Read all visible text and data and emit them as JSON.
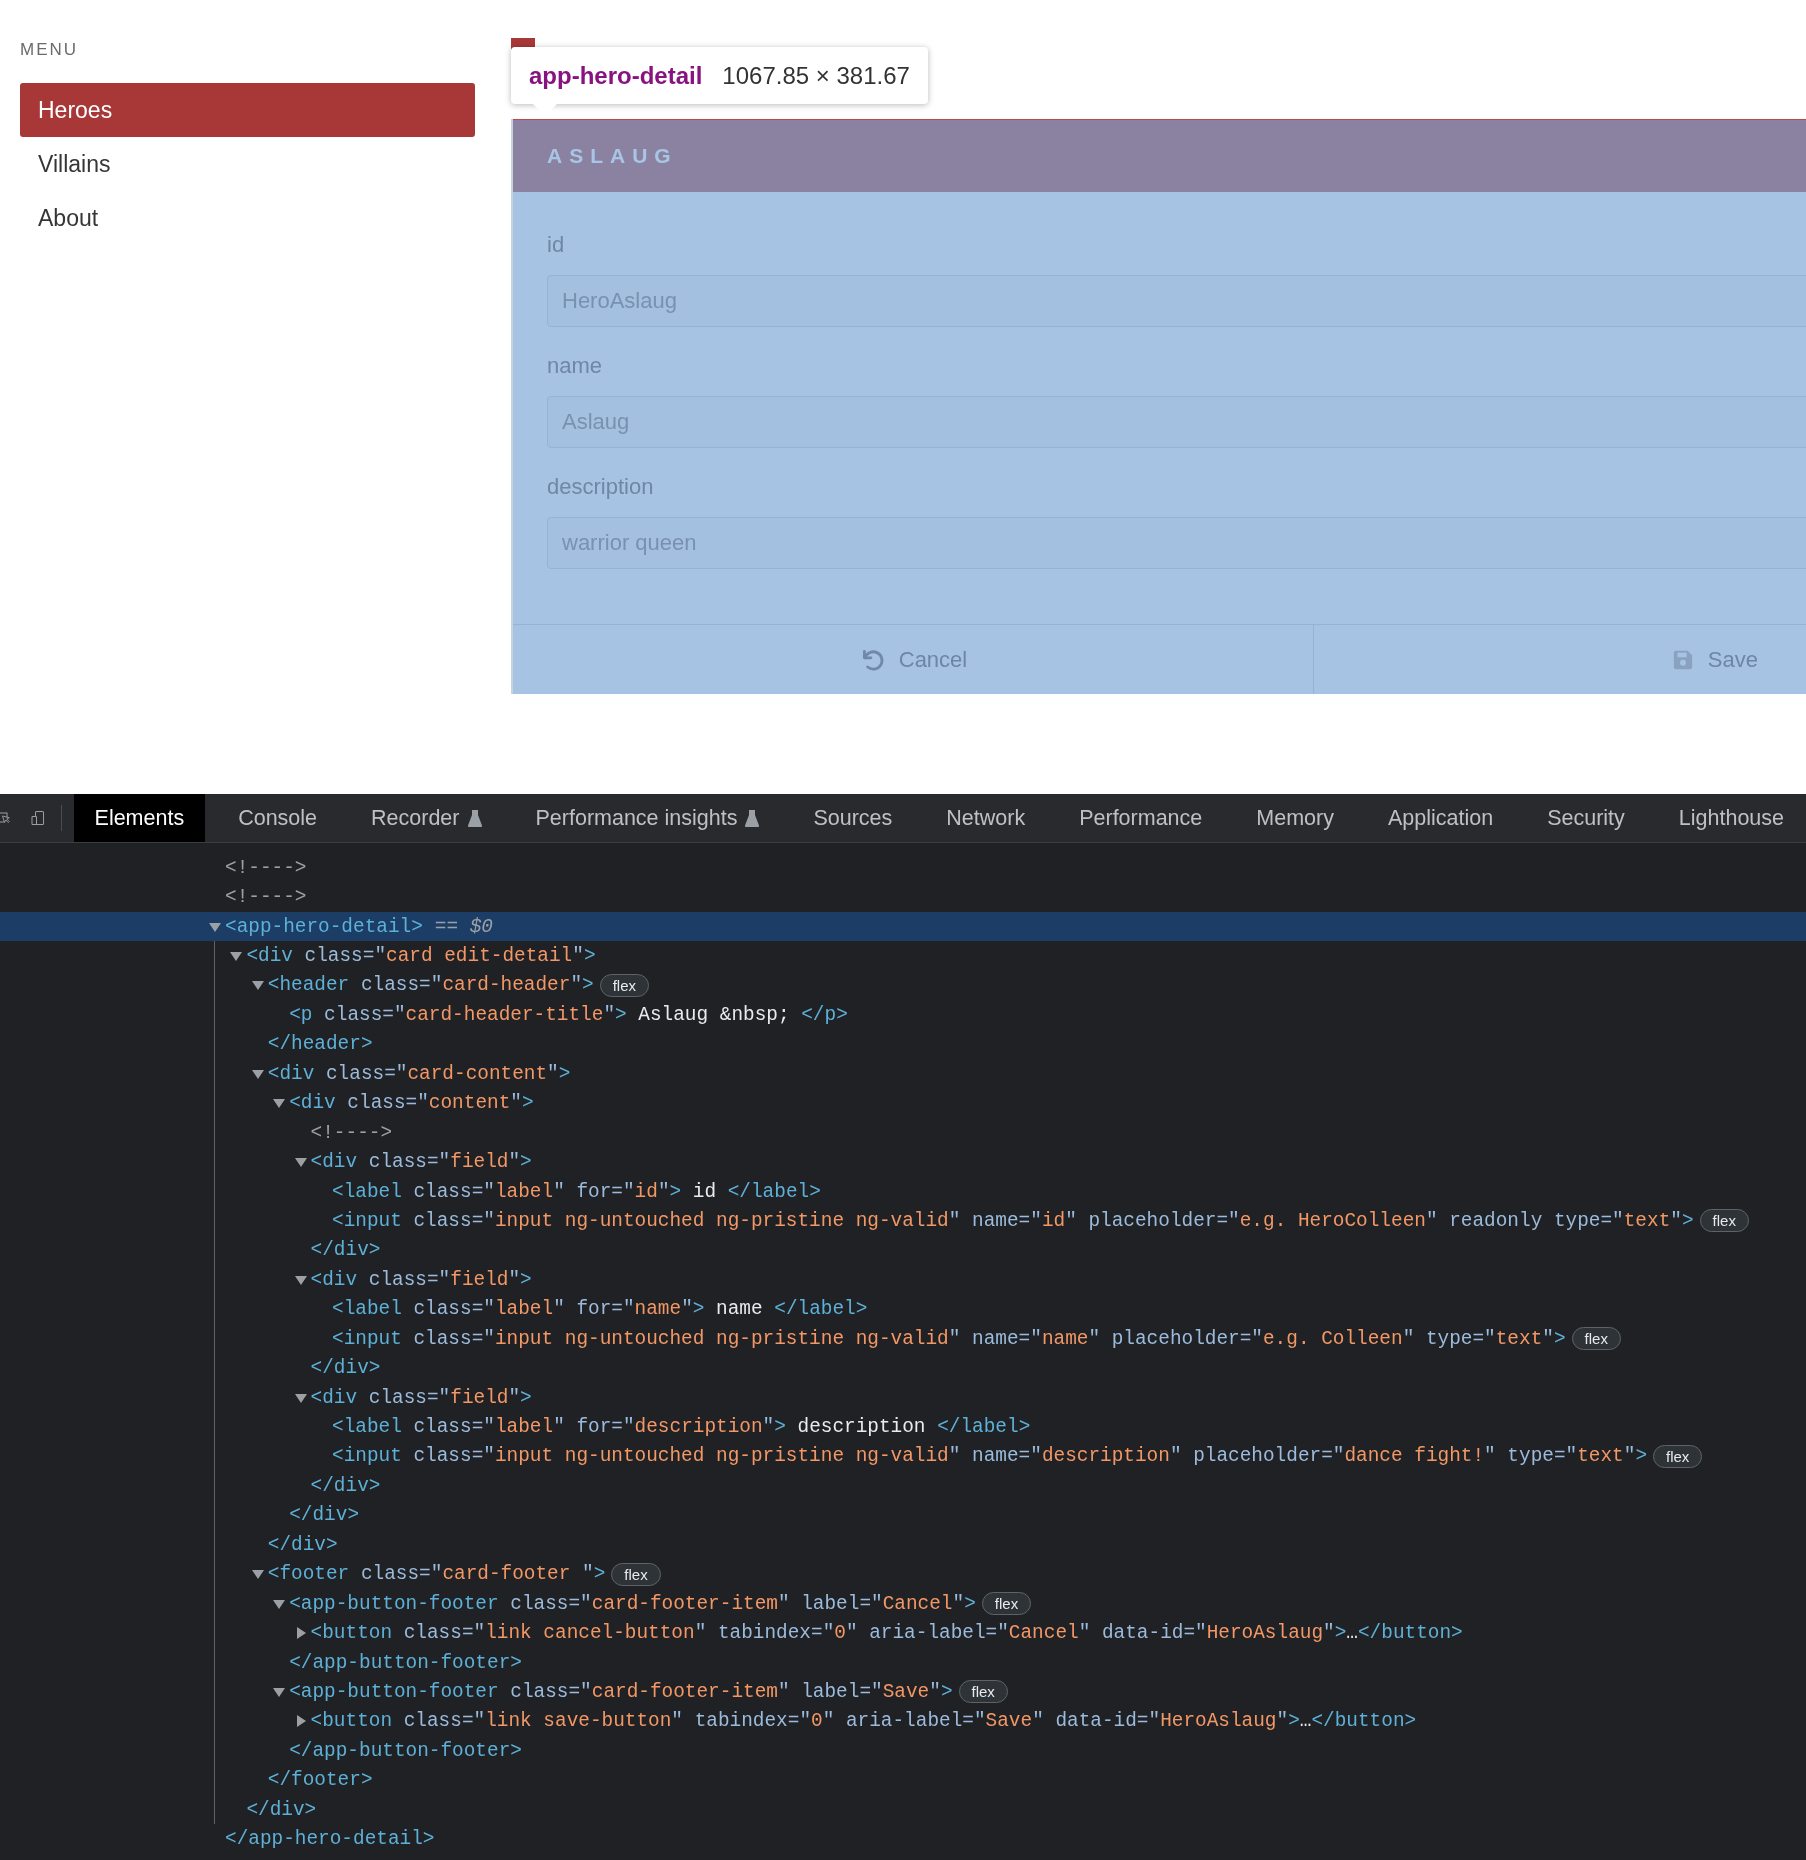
{
  "sidebar": {
    "title": "MENU",
    "items": [
      {
        "label": "Heroes",
        "selected": true
      },
      {
        "label": "Villains",
        "selected": false
      },
      {
        "label": "About",
        "selected": false
      }
    ]
  },
  "inspect_tooltip": {
    "tag": "app-hero-detail",
    "size": "1067.85 × 381.67"
  },
  "hero_card": {
    "title": "ASLAUG",
    "fields": [
      {
        "label": "id",
        "value": "HeroAslaug"
      },
      {
        "label": "name",
        "value": "Aslaug"
      },
      {
        "label": "description",
        "value": "warrior queen"
      }
    ],
    "buttons": [
      {
        "kind": "cancel",
        "label": "Cancel"
      },
      {
        "kind": "save",
        "label": "Save"
      }
    ]
  },
  "devtools": {
    "tabs": [
      {
        "label": "Elements",
        "selected": true,
        "experimental": false
      },
      {
        "label": "Console",
        "selected": false,
        "experimental": false
      },
      {
        "label": "Recorder",
        "selected": false,
        "experimental": true
      },
      {
        "label": "Performance insights",
        "selected": false,
        "experimental": true
      },
      {
        "label": "Sources",
        "selected": false,
        "experimental": false
      },
      {
        "label": "Network",
        "selected": false,
        "experimental": false
      },
      {
        "label": "Performance",
        "selected": false,
        "experimental": false
      },
      {
        "label": "Memory",
        "selected": false,
        "experimental": false
      },
      {
        "label": "Application",
        "selected": false,
        "experimental": false
      },
      {
        "label": "Security",
        "selected": false,
        "experimental": false
      },
      {
        "label": "Lighthouse",
        "selected": false,
        "experimental": false
      }
    ],
    "dom_tree": [
      {
        "text": "<!---->",
        "selected": false
      },
      {
        "text": "<!---->",
        "selected": false
      },
      {
        "text": "<app-hero-detail>",
        "console_ref": "== $0",
        "selected": true,
        "expanded": true,
        "close": "</app-hero-detail>",
        "children": [
          {
            "text": "<div class=\"card edit-detail\">",
            "selected": false,
            "expanded": true,
            "close": "</div>",
            "children": [
              {
                "text": "<header class=\"card-header\">",
                "badge": "flex",
                "selected": false,
                "expanded": true,
                "close": "</header>",
                "children": [
                  {
                    "text": "<p class=\"card-header-title\"> Aslaug &nbsp; </p>",
                    "selected": false
                  }
                ]
              },
              {
                "text": "<div class=\"card-content\">",
                "selected": false,
                "expanded": true,
                "close": "</div>",
                "children": [
                  {
                    "text": "<div class=\"content\">",
                    "selected": false,
                    "expanded": true,
                    "close": "</div>",
                    "children": [
                      {
                        "text": "<!---->",
                        "selected": false
                      },
                      {
                        "text": "<div class=\"field\">",
                        "selected": false,
                        "expanded": true,
                        "close": "</div>",
                        "children": [
                          {
                            "text": "<label class=\"label\" for=\"id\"> id </label>",
                            "selected": false
                          },
                          {
                            "text": "<input class=\"input ng-untouched ng-pristine ng-valid\" name=\"id\" placeholder=\"e.g. HeroColleen\" readonly type=\"text\">",
                            "badge": "flex",
                            "selected": false
                          }
                        ]
                      },
                      {
                        "text": "<div class=\"field\">",
                        "selected": false,
                        "expanded": true,
                        "close": "</div>",
                        "children": [
                          {
                            "text": "<label class=\"label\" for=\"name\"> name </label>",
                            "selected": false
                          },
                          {
                            "text": "<input class=\"input ng-untouched ng-pristine ng-valid\" name=\"name\" placeholder=\"e.g. Colleen\" type=\"text\">",
                            "badge": "flex",
                            "selected": false
                          }
                        ]
                      },
                      {
                        "text": "<div class=\"field\">",
                        "selected": false,
                        "expanded": true,
                        "close": "</div>",
                        "children": [
                          {
                            "text": "<label class=\"label\" for=\"description\"> description </label>",
                            "selected": false
                          },
                          {
                            "text": "<input class=\"input ng-untouched ng-pristine ng-valid\" name=\"description\" placeholder=\"dance fight!\" type=\"text\">",
                            "badge": "flex",
                            "selected": false
                          }
                        ]
                      }
                    ]
                  }
                ]
              },
              {
                "text": "<footer class=\"card-footer \">",
                "badge": "flex",
                "selected": false,
                "expanded": true,
                "close": "</footer>",
                "children": [
                  {
                    "text": "<app-button-footer class=\"card-footer-item\" label=\"Cancel\">",
                    "badge": "flex",
                    "selected": false,
                    "expanded": true,
                    "close": "</app-button-footer>",
                    "children": [
                      {
                        "text": "<button class=\"link cancel-button\" tabindex=\"0\" aria-label=\"Cancel\" data-id=\"HeroAslaug\">…</button>",
                        "selected": false,
                        "expanded": false
                      }
                    ]
                  },
                  {
                    "text": "<app-button-footer class=\"card-footer-item\" label=\"Save\">",
                    "badge": "flex",
                    "selected": false,
                    "expanded": true,
                    "close": "</app-button-footer>",
                    "children": [
                      {
                        "text": "<button class=\"link save-button\" tabindex=\"0\" aria-label=\"Save\" data-id=\"HeroAslaug\">…</button>",
                        "selected": false,
                        "expanded": false
                      }
                    ]
                  }
                ]
              }
            ]
          }
        ]
      }
    ]
  }
}
